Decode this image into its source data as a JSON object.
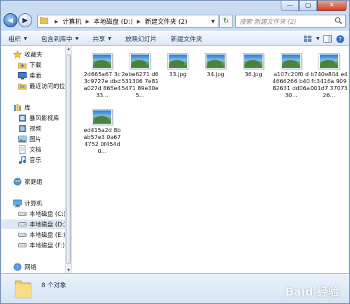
{
  "window": {
    "caption": {
      "minimize": "—",
      "maximize": "▢",
      "close": "✕"
    }
  },
  "address": {
    "crumbs": [
      "计算机",
      "本地磁盘 (D:)",
      "新建文件夹 (2)"
    ]
  },
  "search": {
    "placeholder": "搜索 新建文件夹 (2)"
  },
  "toolbar": {
    "organize": "组织",
    "include_in_library": "包含到库中",
    "share": "共享",
    "slideshow": "放映幻灯片",
    "new_folder": "新建文件夹"
  },
  "nav": {
    "favorites": "收藏夹",
    "downloads": "下载",
    "desktop": "桌面",
    "recent": "最近访问的位置",
    "libraries": "库",
    "storm": "暴风影视库",
    "videos": "视频",
    "pictures": "图片",
    "documents": "文档",
    "music": "音乐",
    "homegroup": "家庭组",
    "computer": "计算机",
    "drive_c": "本地磁盘 (C:)",
    "drive_d": "本地磁盘 (D:)",
    "drive_e": "本地磁盘 (E:)",
    "drive_f": "本地磁盘 (F:)",
    "network": "网络"
  },
  "files": [
    {
      "name": "2d665a67 3c3c9727e dbda027d 865e433..."
    },
    {
      "name": "2ebe6271 d6531306 7e815471 89e30e5..."
    },
    {
      "name": "33.jpg"
    },
    {
      "name": "34.jpg"
    },
    {
      "name": "36.jpg"
    },
    {
      "name": "a107c20f0 d4666266 b4082631 dd06a30..."
    },
    {
      "name": "b740e804 e4fc3416a 909001d7 3707326..."
    },
    {
      "name": "ed415a2d 8bab57e3 0a674752 0f454d0..."
    }
  ],
  "status": {
    "count": "8 个对象"
  },
  "watermark": "Baid 经验"
}
